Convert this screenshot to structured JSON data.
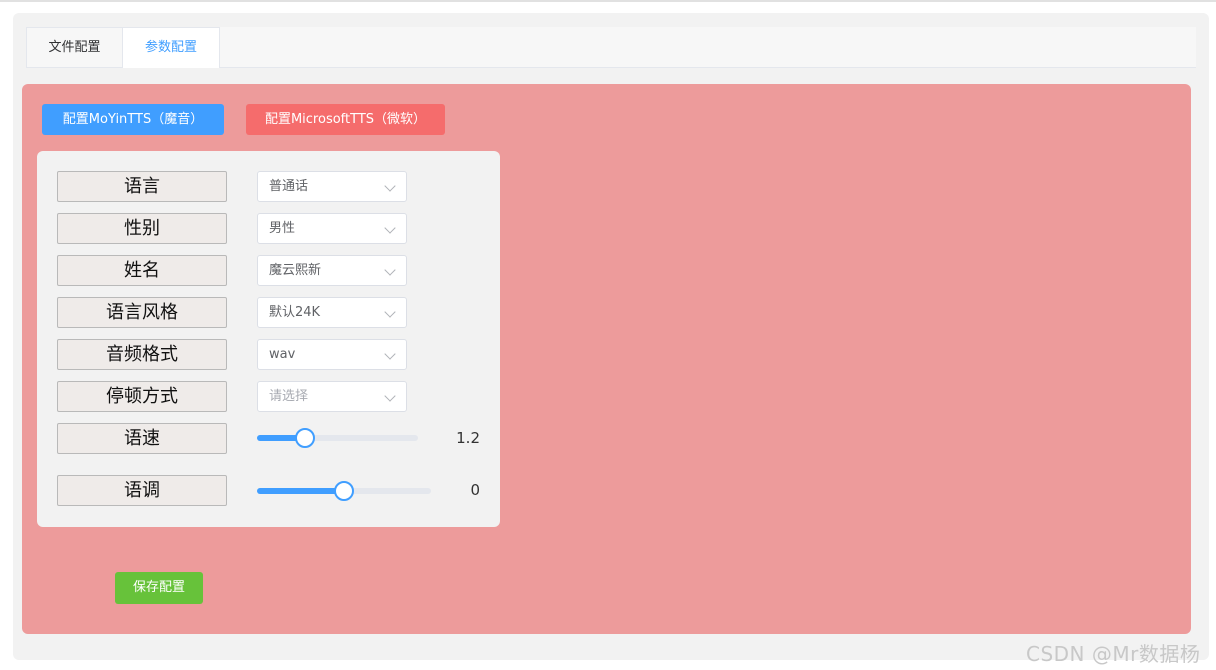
{
  "tabs": [
    {
      "label": "文件配置",
      "active": false
    },
    {
      "label": "参数配置",
      "active": true
    }
  ],
  "engine_buttons": {
    "moyin": "配置MoYinTTS（魔音）",
    "microsoft": "配置MicrosoftTTS（微软）"
  },
  "form": {
    "language": {
      "label": "语言",
      "value": "普通话"
    },
    "gender": {
      "label": "性别",
      "value": "男性"
    },
    "name": {
      "label": "姓名",
      "value": "魔云熙新"
    },
    "style": {
      "label": "语言风格",
      "value": "默认24K"
    },
    "format": {
      "label": "音频格式",
      "value": "wav"
    },
    "pause": {
      "label": "停顿方式",
      "placeholder": "请选择"
    },
    "speed": {
      "label": "语速",
      "value": "1.2",
      "fill_fraction": 0.3
    },
    "pitch": {
      "label": "语调",
      "value": "0",
      "fill_fraction": 0.5
    }
  },
  "save_button": "保存配置",
  "watermark": "CSDN @Mr数据杨",
  "colors": {
    "panel_pink": "#ed9b9b",
    "primary_blue": "#409eff",
    "danger_red": "#f56c6c",
    "success_green": "#67c23a"
  }
}
